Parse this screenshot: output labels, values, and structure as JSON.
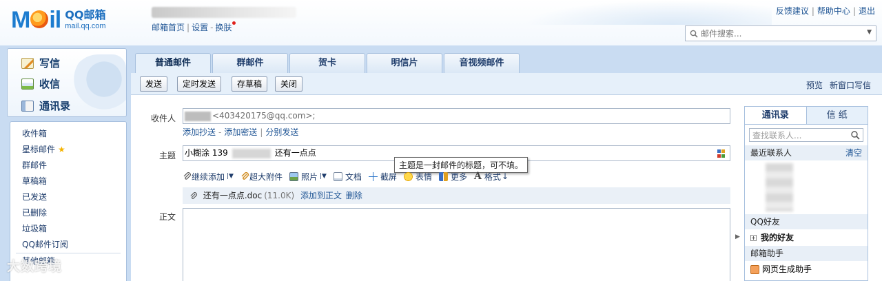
{
  "header": {
    "logo_text": "Mail",
    "logo_cn": "QQ邮箱",
    "logo_url": "mail.qq.com",
    "nav": [
      "邮箱首页",
      "设置",
      "换肤"
    ],
    "links": [
      "反馈建议",
      "帮助中心",
      "退出"
    ],
    "search_placeholder": "邮件搜索..."
  },
  "quick": {
    "write": "写信",
    "inbox": "收信",
    "contacts": "通讯录"
  },
  "folders": [
    "收件箱",
    "星标邮件",
    "群邮件",
    "草稿箱",
    "已发送",
    "已删除",
    "垃圾箱",
    "QQ邮件订阅",
    "其他邮箱"
  ],
  "tabs": [
    "普通邮件",
    "群邮件",
    "贺卡",
    "明信片",
    "音视频邮件"
  ],
  "toolbar": {
    "send": "发送",
    "timed_send": "定时发送",
    "save_draft": "存草稿",
    "close": "关闭",
    "preview": "预览",
    "new_window": "新窗口写信"
  },
  "compose": {
    "to_label": "收件人",
    "to_value": "<403420175@qq.com>;",
    "cc_link": "添加抄送",
    "bcc_link": "添加密送",
    "separate_link": "分别发送",
    "subject_label": "主题",
    "subject_prefix": "小糊涂 139",
    "subject_suffix": "还有一点点",
    "tooltip": "主题是一封邮件的标题，可不填。",
    "attach_continue": "继续添加",
    "attach_large": "超大附件",
    "photo": "照片",
    "doc": "文档",
    "screenshot": "截屏",
    "emoji": "表情",
    "more": "更多",
    "format": "格式",
    "body_label": "正文"
  },
  "attachment": {
    "name": "还有一点点.doc",
    "size": "(11.0K)",
    "add_to_body": "添加到正文",
    "delete": "删除"
  },
  "contacts_panel": {
    "tab_contacts": "通讯录",
    "tab_paper": "信 纸",
    "search_placeholder": "查找联系人...",
    "recent": "最近联系人",
    "clear": "清空",
    "qq_friends": "QQ好友",
    "my_friends": "我的好友",
    "assistant": "邮箱助手",
    "web_gen": "网页生成助手"
  },
  "watermark": "大数跨境",
  "colors": {
    "accent": "#1d7ccf",
    "frame": "#c9dcf2",
    "link": "#1e5494",
    "notify_dot": "#e0201b"
  }
}
